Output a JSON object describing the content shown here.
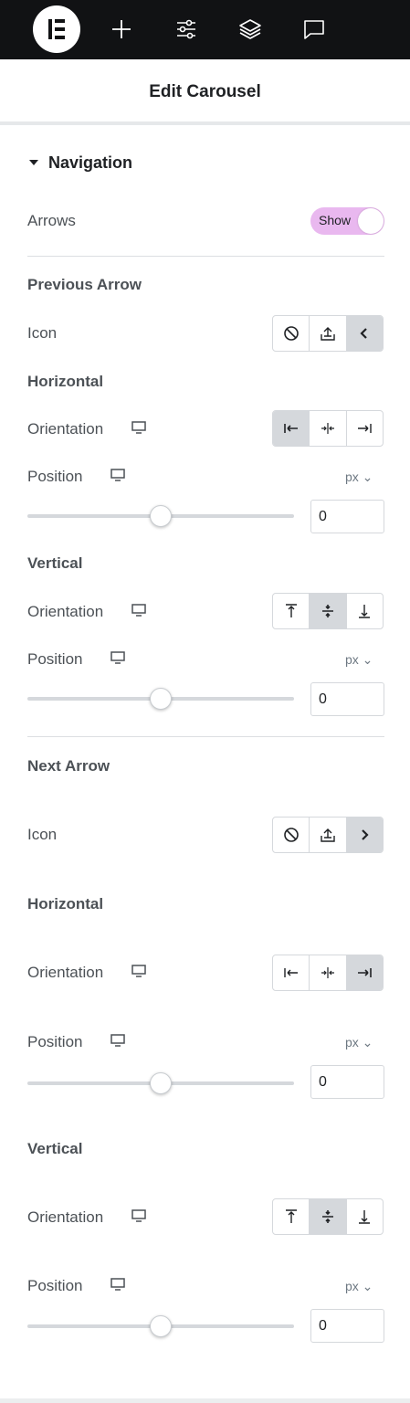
{
  "header": {
    "title": "Edit Carousel"
  },
  "navigation": {
    "section_label": "Navigation",
    "arrows_label": "Arrows",
    "arrows_toggle": "Show"
  },
  "prev_arrow": {
    "title": "Previous Arrow",
    "icon_label": "Icon",
    "horizontal": {
      "title": "Horizontal",
      "orientation_label": "Orientation",
      "position_label": "Position",
      "unit": "px",
      "value": "0",
      "slider_level": 0.5,
      "selected": "left"
    },
    "vertical": {
      "title": "Vertical",
      "orientation_label": "Orientation",
      "position_label": "Position",
      "unit": "px",
      "value": "0",
      "slider_level": 0.5,
      "selected": "middle"
    },
    "selected_icon": "chevron-left"
  },
  "next_arrow": {
    "title": "Next Arrow",
    "icon_label": "Icon",
    "horizontal": {
      "title": "Horizontal",
      "orientation_label": "Orientation",
      "position_label": "Position",
      "unit": "px",
      "value": "0",
      "slider_level": 0.5,
      "selected": "right"
    },
    "vertical": {
      "title": "Vertical",
      "orientation_label": "Orientation",
      "position_label": "Position",
      "unit": "px",
      "value": "0",
      "slider_level": 0.5,
      "selected": "middle"
    },
    "selected_icon": "chevron-right"
  },
  "colors": {
    "topbar": "#111214",
    "toggle_on": "#e9b8ef",
    "active_option": "#d5d8dc"
  },
  "icons": [
    "elementor-logo-icon",
    "plus-icon",
    "sliders-icon",
    "layers-icon",
    "chat-icon",
    "caret-down-icon",
    "monitor-icon",
    "ban-icon",
    "upload-icon",
    "chevron-left-icon",
    "chevron-right-icon",
    "align-left-icon",
    "align-center-icon",
    "align-right-icon",
    "align-top-icon",
    "align-middle-icon",
    "align-bottom-icon"
  ]
}
